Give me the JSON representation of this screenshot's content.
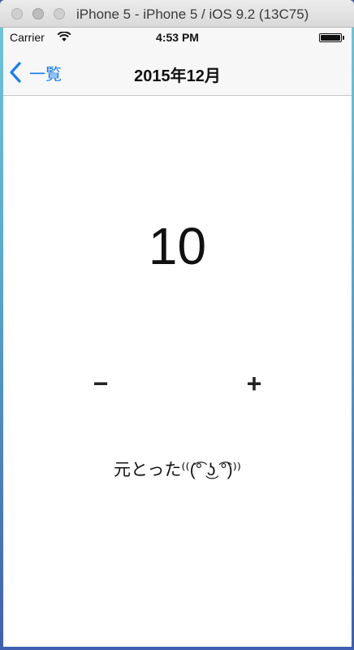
{
  "window": {
    "title": "iPhone 5 - iPhone 5 / iOS 9.2 (13C75)"
  },
  "status_bar": {
    "carrier": "Carrier",
    "time": "4:53 PM"
  },
  "nav": {
    "back_label": "一覧",
    "title": "2015年12月"
  },
  "counter": {
    "value": "10",
    "minus_label": "−",
    "plus_label": "+"
  },
  "message": "元とった⁽⁽(͡° ͜ʖ ͡°)⁾⁾",
  "colors": {
    "accent": "#1a7cf3"
  }
}
